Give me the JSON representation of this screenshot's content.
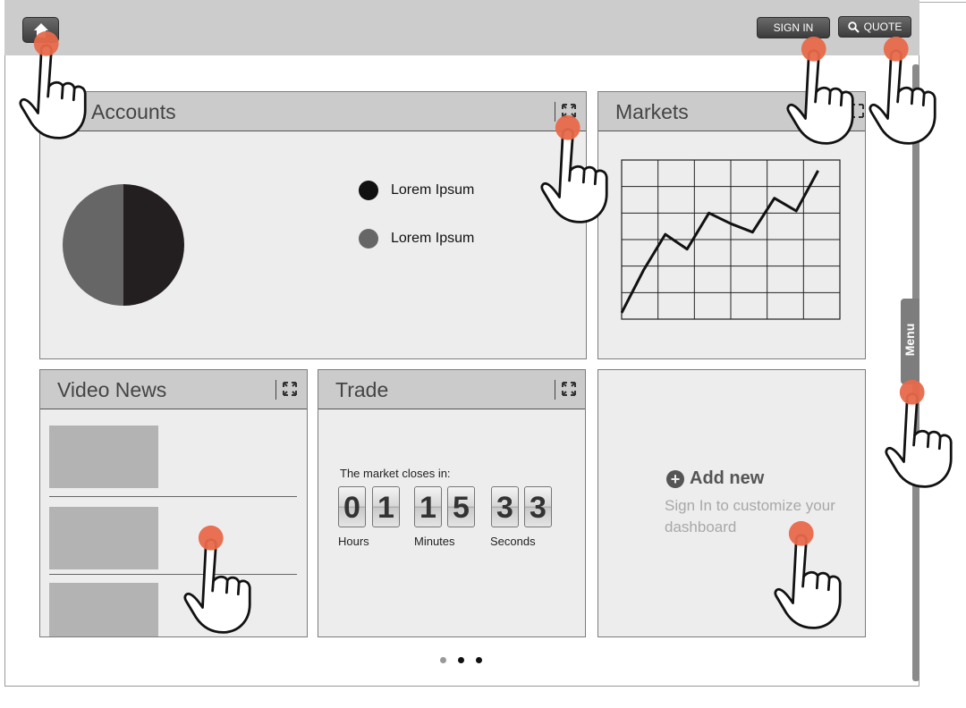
{
  "header": {
    "home_icon": "home-icon",
    "signin_label": "SIGN IN",
    "quote_label": "QUOTE",
    "quote_icon": "search-icon"
  },
  "panels": {
    "accounts": {
      "title": "Accounts",
      "legend": [
        {
          "label": "Lorem Ipsum",
          "color": "#111111"
        },
        {
          "label": "Lorem Ipsum",
          "color": "#666666"
        }
      ],
      "pie": [
        {
          "value": 50,
          "color": "#231f20"
        },
        {
          "value": 50,
          "color": "#666666"
        }
      ]
    },
    "markets": {
      "title": "Markets"
    },
    "video_news": {
      "title": "Video News"
    },
    "trade": {
      "title": "Trade",
      "countdown_label": "The market closes in:",
      "hours": [
        "0",
        "1"
      ],
      "minutes": [
        "1",
        "5"
      ],
      "seconds": [
        "3",
        "3"
      ],
      "hours_label": "Hours",
      "minutes_label": "Minutes",
      "seconds_label": "Seconds"
    },
    "add_new": {
      "title": "Add new",
      "subtitle": "Sign In to customize your dashboard"
    }
  },
  "menu_label": "Menu",
  "pager": {
    "count": 3,
    "active_index": 0
  },
  "colors": {
    "topbar": "#cccccc",
    "panel_bg": "#eeeded",
    "header_bg": "#cbcbcb",
    "touch_marker": "#e8694a"
  },
  "chart_data": {
    "type": "line",
    "title": "",
    "xlabel": "",
    "ylabel": "",
    "grid": true,
    "x": [
      0,
      1,
      2,
      3,
      4,
      5,
      6,
      7,
      8,
      9
    ],
    "series": [
      {
        "values": [
          0.3,
          2.3,
          4.0,
          3.3,
          5.0,
          4.5,
          4.1,
          5.7,
          5.1,
          7.0
        ]
      }
    ],
    "xlim": [
      0,
      10
    ],
    "ylim": [
      0,
      7.5
    ]
  }
}
